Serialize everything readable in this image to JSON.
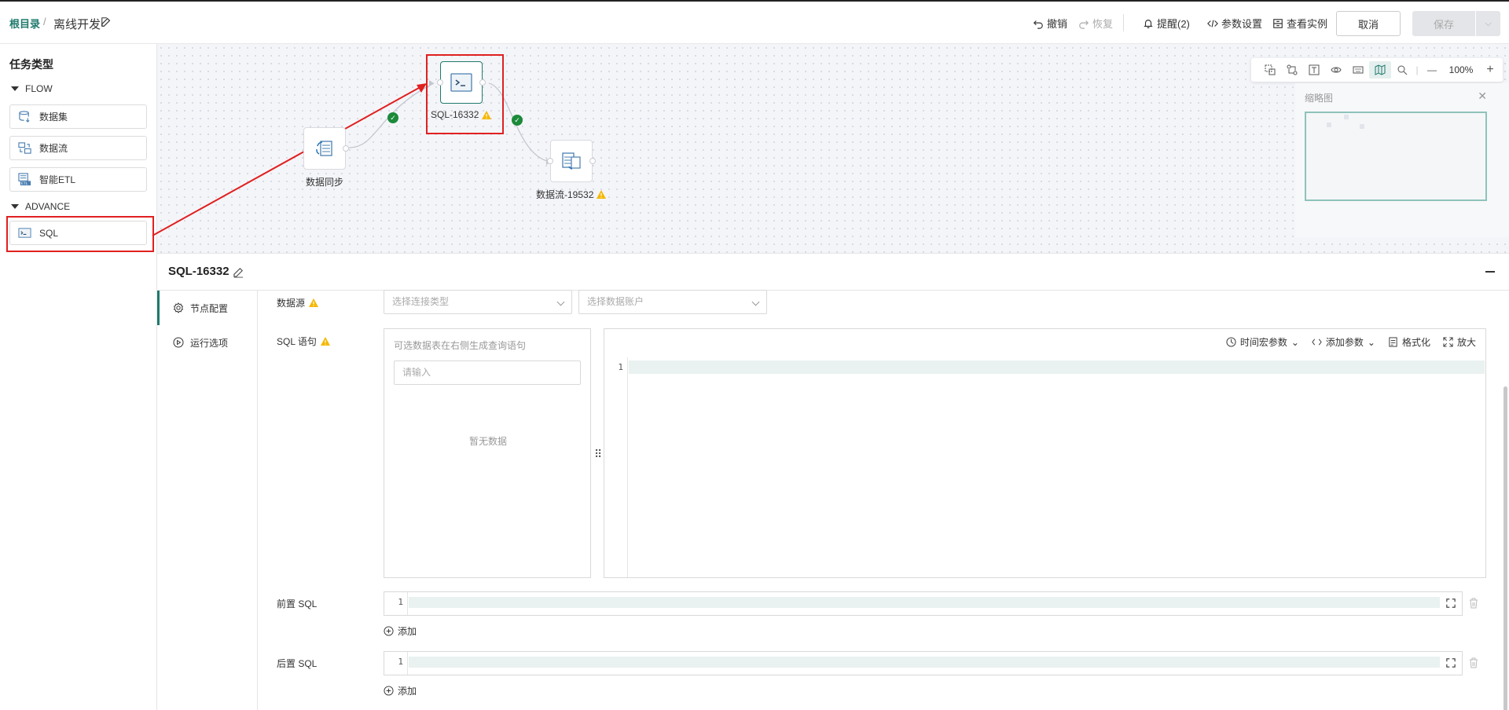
{
  "header": {
    "breadcrumb_root": "根目录",
    "breadcrumb_sep": "/",
    "breadcrumb_current": "离线开发",
    "undo": "撤销",
    "redo": "恢复",
    "alerts": "提醒(2)",
    "params": "参数设置",
    "instances": "查看实例",
    "cancel": "取消",
    "save": "保存"
  },
  "sidebar": {
    "title": "任务类型",
    "groups": [
      {
        "name": "FLOW",
        "items": [
          "数据集",
          "数据流",
          "智能ETL"
        ]
      },
      {
        "name": "ADVANCE",
        "items": [
          "SQL"
        ]
      }
    ]
  },
  "canvas": {
    "nodes": [
      {
        "label": "数据同步",
        "warning": false
      },
      {
        "label": "SQL-16332",
        "warning": true
      },
      {
        "label": "数据流-19532",
        "warning": true
      }
    ],
    "zoom": "100%",
    "minimap_title": "缩略图"
  },
  "panel": {
    "title": "SQL-16332",
    "tabs": [
      "节点配置",
      "运行选项"
    ],
    "fields": {
      "datasource_label": "数据源",
      "conn_type_placeholder": "选择连接类型",
      "account_placeholder": "选择数据账户",
      "sql_label": "SQL 语句",
      "table_hint": "可选数据表在右侧生成查询语句",
      "table_search_placeholder": "请输入",
      "table_empty": "暂无数据",
      "pre_sql_label": "前置 SQL",
      "post_sql_label": "后置 SQL",
      "add": "添加",
      "line_number": "1"
    },
    "editor_tools": [
      "时间宏参数",
      "添加参数",
      "格式化",
      "放大"
    ]
  },
  "colors": {
    "accent": "#1f7a6c",
    "annotation": "#e02020",
    "success": "#1b8a3a",
    "warning": "#f5b800"
  }
}
